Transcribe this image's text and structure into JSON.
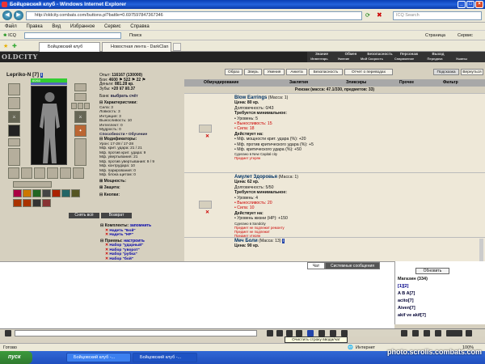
{
  "window": {
    "title": "Бойцовский клуб - Windows Internet Explorer"
  },
  "browser": {
    "url": "http://oldcity.combats.com/buttons.pl?battle=0.697597847367346",
    "search_placeholder": "ICQ Search",
    "menu": [
      "Файл",
      "Правка",
      "Вид",
      "Избранное",
      "Сервис",
      "Справка"
    ],
    "links": {
      "icq": "ICQ",
      "search": "Поиск",
      "page": "Страница",
      "service": "Сервис"
    },
    "tabs": [
      {
        "label": "Бойцовский клуб",
        "active": true
      },
      {
        "label": "Новостная лента - DarkClan",
        "active": false
      }
    ]
  },
  "game": {
    "logo": "OLDCITY",
    "top_menu_row1": [
      "Знание",
      "Обмен",
      "Безопасность",
      "Персонаж",
      "Выход"
    ],
    "top_menu_row2": [
      "Инвентарь",
      "Умение",
      "Мой Скорость",
      "Снаряжение",
      "Передача",
      "Ушины"
    ],
    "character": {
      "name": "Lepriko-N [7]",
      "hp": "60/60",
      "bank_label": "Банк:",
      "bank_link": "выбрать счёт",
      "stats_label": "Характеристики:",
      "stats": [
        "Сила: 3",
        "Ловкость: 3",
        "Интуиция: 3",
        "Выносливость: 10",
        "Интеллект: 0",
        "Мудрость: 0"
      ],
      "abilities_link": "Способности • Обучение",
      "modifiers_label": "Модификаторы:",
      "modifiers": [
        "Урон: 17-28 / 17-28",
        "Мф. крит. удара: 21 / 21",
        "Мф. против крит. удара: 9",
        "Мф. увертывания: 21",
        "Мф. против увертывания: 9 / 9",
        "Мф. контрудара: 10",
        "Мф. парирования: 0",
        "Мф. блока щитом: 0"
      ],
      "power_label": "Мощность:",
      "defense_label": "Защита:",
      "buttons_label": "Кнопки:",
      "btn_remove_all": "Снять всё",
      "btn_return": "Возврат",
      "sets_label": "Комплекты:",
      "sets_remember": "запомнить",
      "sets": [
        "Надеть \"Бой\"",
        "Надеть \"НР\""
      ],
      "techniques_label": "Приемы:",
      "techniques_configure": "настроить",
      "techniques": [
        "Набор \"ударный\"",
        "Набор \"уворот\"",
        "Набор \"рубка\"",
        "Набор \"бой\""
      ]
    },
    "money": {
      "exp_label": "Опыт:",
      "exp": "116167 (130000)",
      "battles_label": "Бои:",
      "battles": "4600 ⚑ 522 ⚑ 22 ⚑",
      "money_label": "Деньги:",
      "money": "881.28 кр.",
      "teeth_label": "Зубы:",
      "teeth": "×20 ¥7 ¥0.37"
    },
    "inventory": {
      "top_buttons": [
        "Образ",
        "Зверь",
        "Умения",
        "Анкета",
        "Безопасность",
        "Отчет о переводах",
        "Подсказка",
        "Вернуться"
      ],
      "header": [
        "Обмундирование",
        "Заклятия",
        "Эликсиры",
        "Прочее",
        "Фильтр"
      ],
      "rucksack": "Рюкзак (масса: 47.1/330, предметов: 33)",
      "items": [
        {
          "name": "Blow Earrings",
          "mass": "(Масса: 1)",
          "price": "Цена: 80 кр.",
          "durability": "Долговечность: 0/43",
          "req_label": "Требуется минимальное:",
          "reqs": [
            {
              "t": "• Уровень: 5",
              "red": false
            },
            {
              "t": "• Выносливость: 15",
              "red": true
            },
            {
              "t": "• Сила: 18",
              "red": true
            }
          ],
          "acts_label": "Действует на:",
          "acts": [
            "• Мф. мощности крит. удара (%): +20",
            "• Мф. против критического удара (%): +5",
            "• Мф. критического удара (%): +50"
          ],
          "note": "Сделано в New Capital city",
          "note2": "Предмет утерян"
        },
        {
          "name": "Амулет Здоровья",
          "mass": "(Масса: 1)",
          "price": "Цена: 62 кр.",
          "durability": "Долговечность: 5/50",
          "req_label": "Требуется минимальное:",
          "reqs": [
            {
              "t": "• Уровень: 4",
              "red": false
            },
            {
              "t": "• Выносливость: 20",
              "red": true
            },
            {
              "t": "• Сила: 10",
              "red": true
            }
          ],
          "acts_label": "Действует на:",
          "acts": [
            "• Уровень жизни (HP): +150"
          ],
          "note": "Сделано в Sandcity",
          "note2": "Предмет не подлежит ремонту",
          "note3": "Предмет не подлежит",
          "note4": "Предмет утерян"
        },
        {
          "name": "Меч Боли",
          "mass": "(Масса: 13)",
          "price": "Цена: 90 кр."
        }
      ]
    },
    "chat": {
      "tab_chat": "Чат",
      "tab_system": "Системные сообщения"
    },
    "online": {
      "refresh": "Обновить",
      "room": "Магазин (334)",
      "pages": "[1][2]",
      "users": [
        "A B A[7]",
        "acito[7]",
        "Aiven[7]",
        "akif ve akif[7]"
      ]
    },
    "tooltip": "Очистить строку ввода/чат"
  },
  "status": {
    "left": "Готово",
    "zone": "Интернет",
    "zoom": "100%"
  },
  "taskbar": {
    "start": "пуск",
    "tasks": [
      "Бойцовский клуб -...",
      "Бойцовский клуб -..."
    ]
  },
  "watermark": "photo.scrolls.combats.com"
}
